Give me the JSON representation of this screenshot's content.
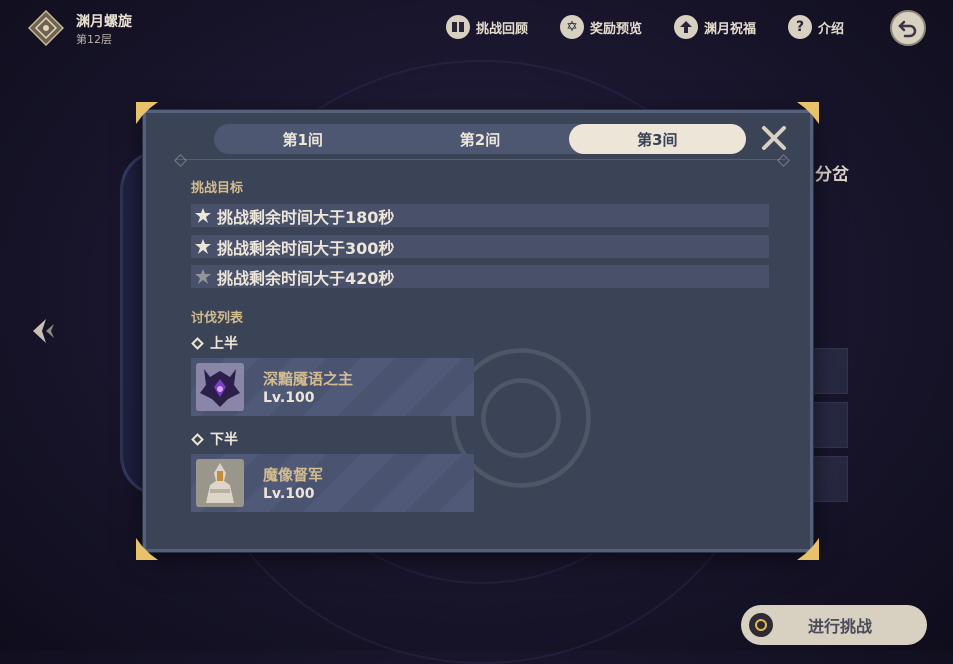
{
  "header": {
    "title": "渊月螺旋",
    "floor": "第12层",
    "actions": [
      {
        "label": "挑战回顾",
        "icon": "book-icon"
      },
      {
        "label": "奖励预览",
        "icon": "star-icon"
      },
      {
        "label": "渊月祝福",
        "icon": "blessing-icon"
      },
      {
        "label": "介绍",
        "icon": "help-icon"
      }
    ],
    "back_icon": "back-arrow-icon"
  },
  "background": {
    "partial_text": "分岔"
  },
  "modal": {
    "tabs": [
      "第1间",
      "第2间",
      "第3间"
    ],
    "active_tab": "第3间",
    "objectives_title": "挑战目标",
    "objectives": [
      {
        "text": "挑战剩余时间大于180秒",
        "achieved": true
      },
      {
        "text": "挑战剩余时间大于300秒",
        "achieved": true
      },
      {
        "text": "挑战剩余时间大于420秒",
        "achieved": false
      }
    ],
    "enemy_list_title": "讨伐列表",
    "halves": [
      {
        "label": "上半",
        "enemy": {
          "name": "深黯魇语之主",
          "level": "Lv.100"
        }
      },
      {
        "label": "下半",
        "enemy": {
          "name": "魔像督军",
          "level": "Lv.100"
        }
      }
    ]
  },
  "challenge_button": {
    "label": "进行挑战"
  },
  "colors": {
    "modal_bg": "#3b4356",
    "accent_gold": "#d3bc8e",
    "tab_active": "#ece5d8"
  }
}
